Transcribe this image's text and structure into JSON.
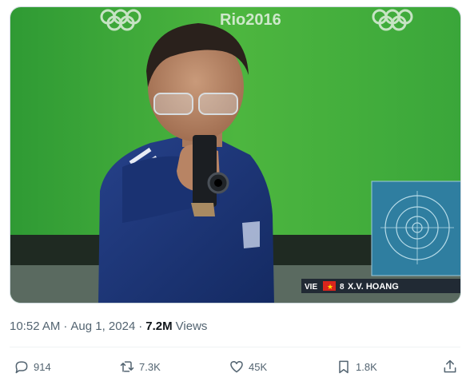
{
  "media": {
    "watermark": "Rio2016",
    "lower_third": {
      "country_code": "VIE",
      "lane": "8",
      "athlete": "X.V. HOANG"
    }
  },
  "tweet": {
    "time": "10:52 AM",
    "separator": "·",
    "date": "Aug 1, 2024",
    "views_count": "7.2M",
    "views_label": "Views"
  },
  "actions": {
    "replies": "914",
    "retweets": "7.3K",
    "likes": "45K",
    "bookmarks": "1.8K"
  },
  "icons": [
    "reply-icon",
    "retweet-icon",
    "like-icon",
    "bookmark-icon",
    "share-icon"
  ],
  "colors": {
    "background_green": "#3fae3a",
    "shooter_jacket": "#1d3577",
    "target_panel": "#2f7ea0",
    "muted_text": "#536471",
    "text": "#0f1419"
  }
}
